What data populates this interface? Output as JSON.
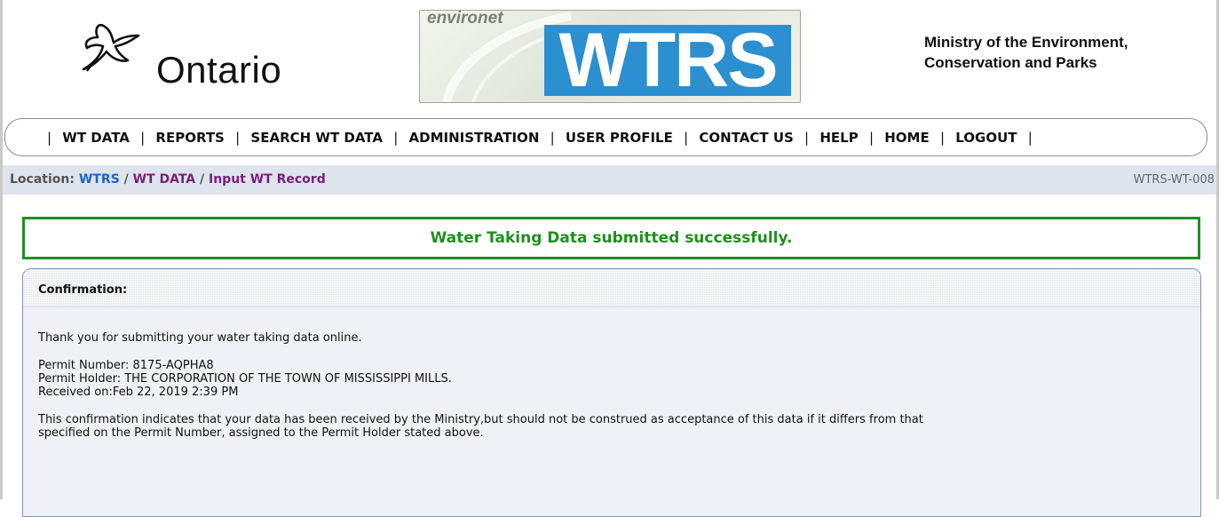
{
  "header": {
    "ontario_logo_text": "Ontario",
    "banner_environet": "environet",
    "banner_wtrs": "WTRS",
    "ministry_line1": "Ministry of the Environment,",
    "ministry_line2": "Conservation and Parks"
  },
  "nav": {
    "items": [
      {
        "label": "WT DATA"
      },
      {
        "label": "REPORTS"
      },
      {
        "label": "SEARCH WT DATA"
      },
      {
        "label": "ADMINISTRATION"
      },
      {
        "label": "USER PROFILE"
      },
      {
        "label": "CONTACT US"
      },
      {
        "label": "HELP"
      },
      {
        "label": "HOME"
      },
      {
        "label": "LOGOUT"
      }
    ],
    "separator": "|"
  },
  "location": {
    "label": "Location:",
    "crumbs": [
      "WTRS",
      "WT DATA",
      "Input WT Record"
    ],
    "separator": "/",
    "screen_id": "WTRS-WT-008"
  },
  "success_message": "Water Taking Data submitted successfully.",
  "confirmation": {
    "title": "Confirmation:",
    "thank_you": "Thank you for submitting your water taking data online.",
    "permit_number": "Permit Number: 8175-AQPHA8",
    "permit_holder": "Permit Holder: THE CORPORATION OF THE TOWN OF MISSISSIPPI MILLS.",
    "received_on": "Received on:Feb 22, 2019 2:39 PM",
    "disclaimer_line1": "This confirmation indicates that your data has been received by the Ministry,but should not be construed as acceptance of this data if it differs from that",
    "disclaimer_line2": "specified on the Permit Number, assigned to the Permit Holder stated above."
  },
  "colors": {
    "success_green": "#1f8f1f",
    "link_blue": "#1e63c8",
    "link_purple": "#7a1f7e",
    "banner_blue": "#2b8fd0"
  }
}
